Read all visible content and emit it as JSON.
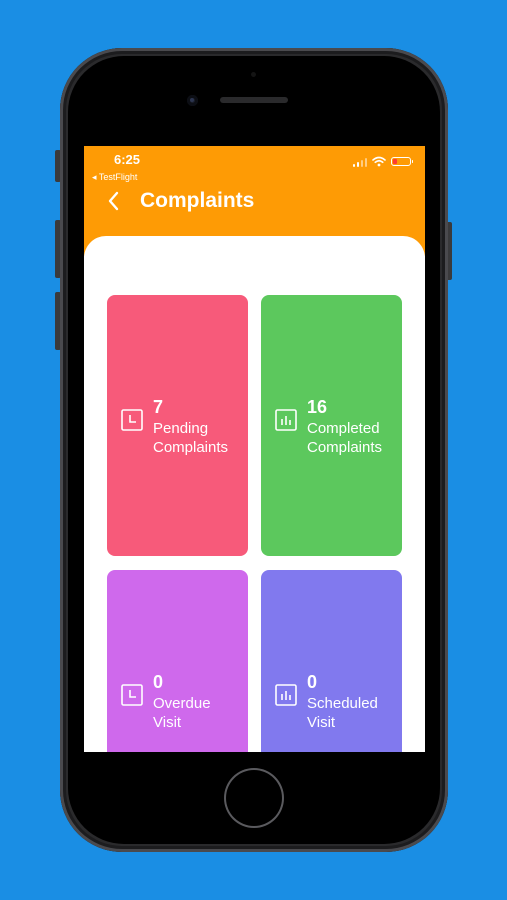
{
  "status_bar": {
    "time": "6:25",
    "back_app": "◂ TestFlight"
  },
  "header": {
    "title": "Complaints",
    "back_icon": "chevron-left-icon"
  },
  "cards": {
    "pending": {
      "count": "7",
      "line1": "Pending",
      "line2": "Complaints",
      "icon": "clock-icon",
      "color": "#f75a7a"
    },
    "completed": {
      "count": "16",
      "line1": "Completed",
      "line2": "Complaints",
      "icon": "bar-chart-icon",
      "color": "#5cc85d"
    },
    "overdue": {
      "count": "0",
      "line1": "Overdue",
      "line2": "Visit",
      "icon": "clock-icon",
      "color": "#cf69ec"
    },
    "scheduled": {
      "count": "0",
      "line1": "Scheduled",
      "line2": "Visit",
      "icon": "bar-chart-icon",
      "color": "#8179ee"
    }
  },
  "colors": {
    "background": "#1a8ee4",
    "appbar": "#fe9b05"
  }
}
